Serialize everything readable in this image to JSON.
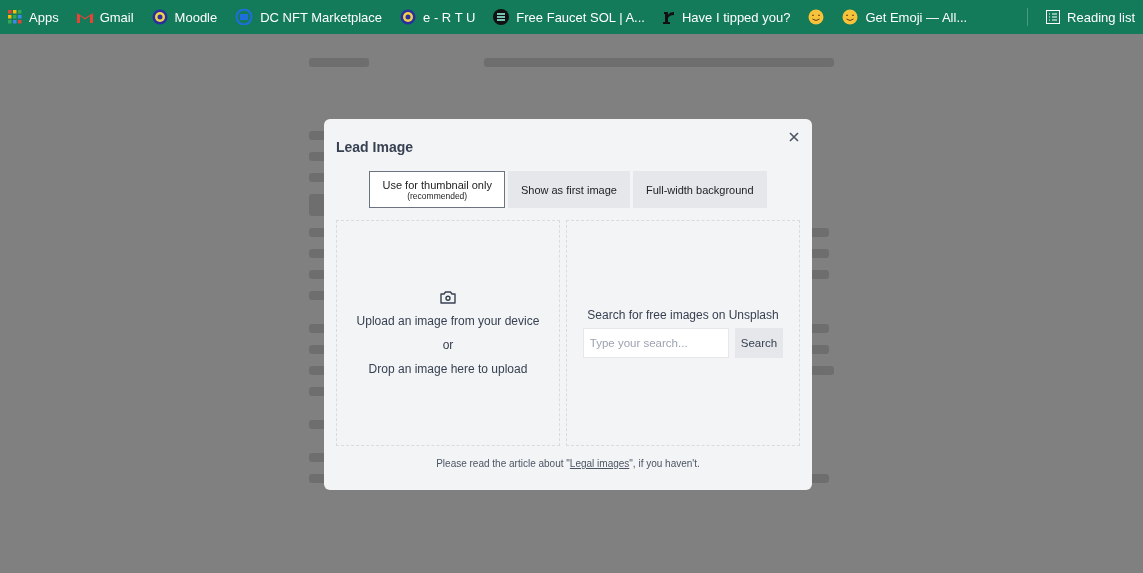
{
  "bookmarks": [
    {
      "label": "Apps",
      "kind": "apps"
    },
    {
      "label": "Gmail",
      "kind": "gmail"
    },
    {
      "label": "Moodle",
      "kind": "seal"
    },
    {
      "label": "DC NFT Marketplace",
      "kind": "dc"
    },
    {
      "label": "e - R T U",
      "kind": "seal"
    },
    {
      "label": "Free Faucet SOL | A...",
      "kind": "sol"
    },
    {
      "label": "Have I tipped you?",
      "kind": "r"
    },
    {
      "kind": "emoji"
    },
    {
      "label": "Get Emoji — All...",
      "kind": "emoji"
    }
  ],
  "reading_list": {
    "label": "Reading list"
  },
  "dialog": {
    "title": "Lead Image",
    "options": [
      {
        "label": "Use for thumbnail only",
        "note": "(recommended)",
        "selected": true
      },
      {
        "label": "Show as first image",
        "selected": false
      },
      {
        "label": "Full-width background",
        "selected": false
      }
    ],
    "upload": {
      "line_1": "Upload an image from your device",
      "line_2": "or",
      "line_3": "Drop an image here to upload"
    },
    "unsplash": {
      "heading": "Search for free images on Unsplash",
      "placeholder": "Type your search...",
      "button": "Search"
    },
    "footer": {
      "before": "Please read the article about \"",
      "link": "Legal images",
      "after": "\", if you haven't."
    }
  }
}
